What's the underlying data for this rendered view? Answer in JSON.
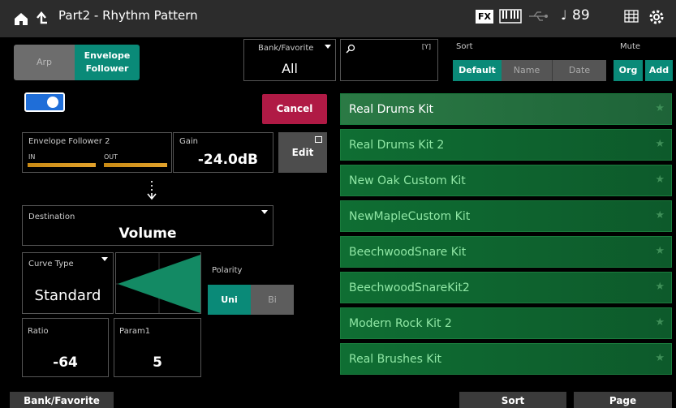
{
  "header": {
    "title": "Part2 - Rhythm Pattern",
    "fx_label": "FX",
    "note_symbol": "♩",
    "tempo": "89",
    "icons": [
      "home-icon",
      "back-icon",
      "keyboard-icon",
      "usb-icon",
      "grid-icon",
      "gear-icon"
    ]
  },
  "mode_tabs": {
    "arp_label": "Arp",
    "envelope_label_1": "Envelope",
    "envelope_label_2": "Follower",
    "selected": "Envelope Follower"
  },
  "bank": {
    "label": "Bank/Favorite",
    "value": "All"
  },
  "search": {
    "value": "",
    "icon_text": "[Y]"
  },
  "sort": {
    "label": "Sort",
    "options": [
      "Default",
      "Name",
      "Date"
    ],
    "selected": "Default"
  },
  "mute": {
    "label": "Mute",
    "org_label": "Org",
    "add_label": "Add"
  },
  "switch_on": true,
  "cancel_label": "Cancel",
  "envelope_follower": {
    "label": "Envelope Follower 2",
    "in_label": "IN",
    "out_label": "OUT",
    "gain_label": "Gain",
    "gain_value": "-24.0dB",
    "edit_label": "Edit"
  },
  "destination": {
    "label": "Destination",
    "value": "Volume"
  },
  "curve": {
    "label": "Curve Type",
    "value": "Standard"
  },
  "polarity": {
    "label": "Polarity",
    "options": [
      "Uni",
      "Bi"
    ],
    "selected": "Uni"
  },
  "ratio": {
    "label": "Ratio",
    "value": "-64"
  },
  "param1": {
    "label": "Param1",
    "value": "5"
  },
  "patterns": [
    "Real Drums Kit",
    "Real Drums Kit 2",
    "New Oak Custom Kit",
    "NewMapleCustom Kit",
    "BeechwoodSnare Kit",
    "BeechwoodSnareKit2",
    "Modern Rock Kit 2",
    "Real Brushes Kit"
  ],
  "selected_pattern": "Real Drums Kit",
  "bottom_tabs": {
    "bank_label": "Bank/Favorite",
    "sort_label": "Sort",
    "page_label": "Page"
  },
  "colors": {
    "accent_teal": "#0a8a78",
    "cancel_red": "#b01a45",
    "list_green": "#0f6e33",
    "toggle_blue": "#1f6ed8"
  }
}
